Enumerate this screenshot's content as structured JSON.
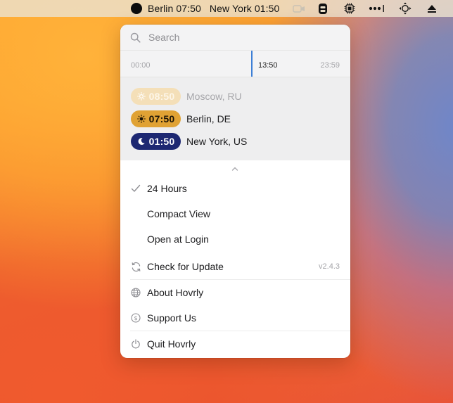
{
  "menubar": {
    "status_items": [
      {
        "text": "Berlin 07:50"
      },
      {
        "text": "New York 01:50"
      }
    ],
    "icons": [
      "faded-app-icon",
      "tabs-icon",
      "cpu-icon",
      "wifi-dots-icon",
      "move-icon",
      "eject-icon"
    ]
  },
  "search": {
    "placeholder": "Search"
  },
  "timeline": {
    "start_label": "00:00",
    "current_label": "13:50",
    "end_label": "23:59",
    "accent_color": "#3d7fd6"
  },
  "cities": [
    {
      "time": "08:50",
      "name": "Moscow, RU",
      "icon": "sun-icon",
      "style": "faded"
    },
    {
      "time": "07:50",
      "name": "Berlin, DE",
      "icon": "sun-icon",
      "style": "day"
    },
    {
      "time": "01:50",
      "name": "New York, US",
      "icon": "moon-icon",
      "style": "night"
    }
  ],
  "menu": {
    "items": [
      {
        "label": "24 Hours",
        "icon": "checkmark-icon",
        "checked": true
      },
      {
        "label": "Compact View"
      },
      {
        "label": "Open at Login"
      },
      {
        "label": "Check for Update",
        "icon": "refresh-icon",
        "badge": "v2.4.3"
      },
      {
        "label": "About Hovrly",
        "icon": "globe-icon"
      },
      {
        "label": "Support Us",
        "icon": "dollar-coin-icon"
      },
      {
        "label": "Quit Hovrly",
        "icon": "power-icon"
      }
    ]
  },
  "colors": {
    "day_pill": "#e0a234",
    "night_pill": "#1d2872",
    "faded_pill": "#f4dfb8"
  }
}
